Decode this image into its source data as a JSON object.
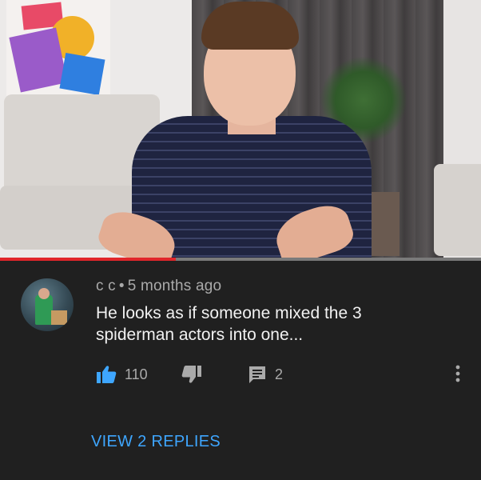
{
  "video": {
    "progress_fraction": 0.365
  },
  "comment": {
    "author": "c c",
    "separator": "•",
    "time": "5 months ago",
    "text_lines": [
      "He looks as if someone mixed the 3",
      "spiderman actors into one..."
    ],
    "likes": "110",
    "replies_count": "2",
    "view_replies_label": "VIEW 2 REPLIES"
  },
  "icons": {
    "like": "thumbs-up-icon",
    "dislike": "thumbs-down-icon",
    "reply": "comment-icon",
    "more": "more-vert-icon"
  },
  "colors": {
    "background": "#202020",
    "accent_blue": "#3ea6ff",
    "progress_red": "#e0262b",
    "meta_gray": "#aaaaaa"
  }
}
